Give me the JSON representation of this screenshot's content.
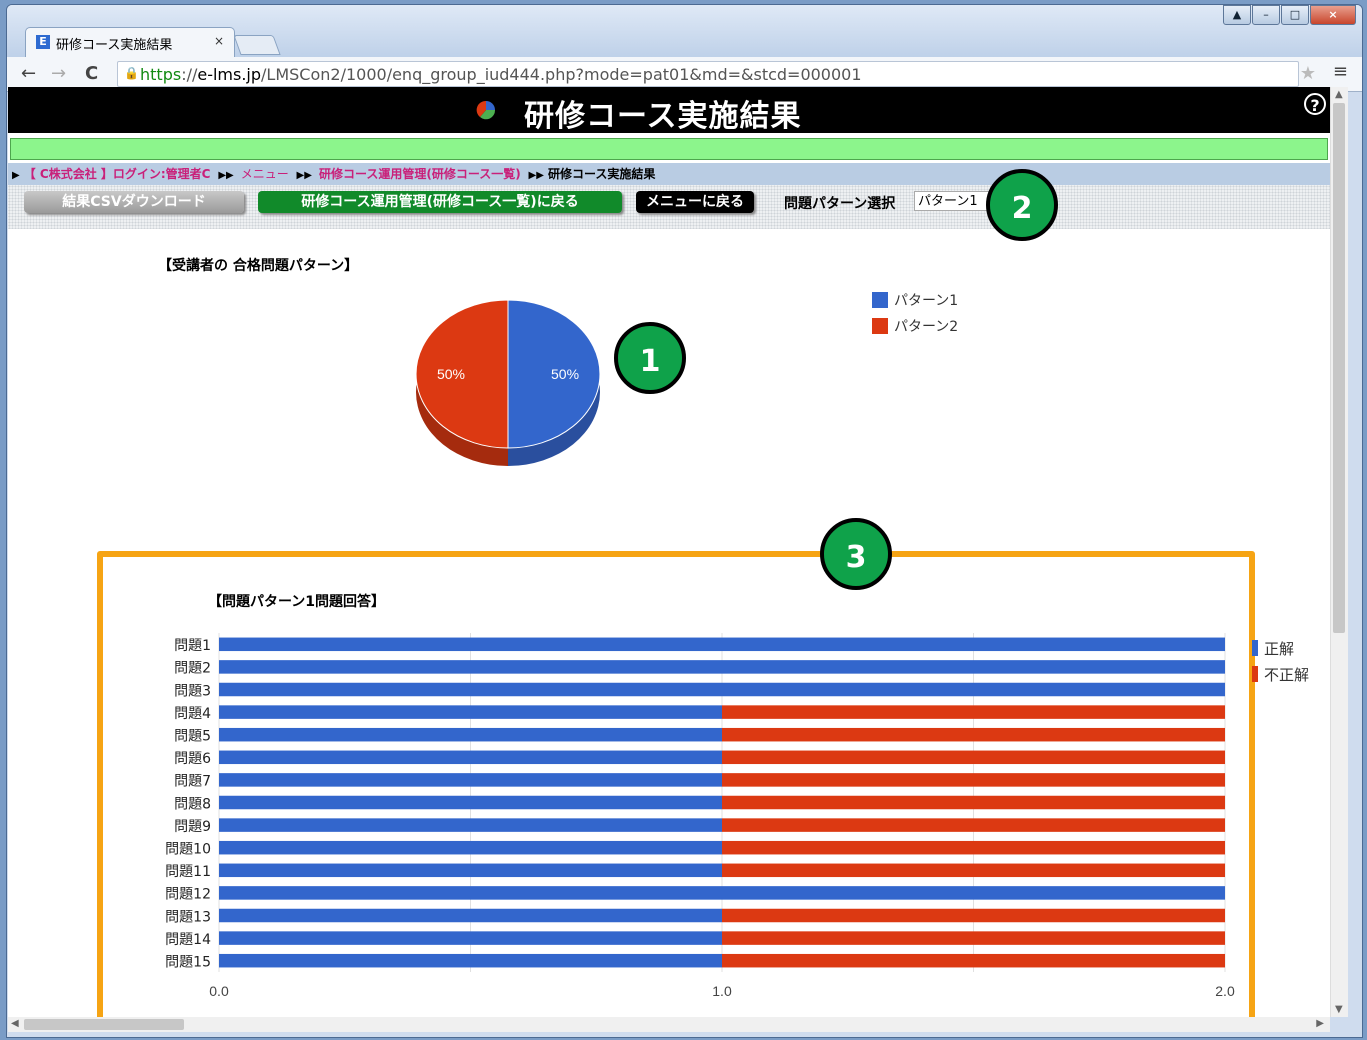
{
  "browser": {
    "tab_title": "研修コース実施結果",
    "tab_favicon": "E",
    "tab_close": "×",
    "url_scheme": "https",
    "url_sep": "://",
    "url_host": "e-lms.jp",
    "url_path": "/LMSCon2/1000/enq_group_iud444.php?mode=pat01&md=&stcd=000001"
  },
  "header": {
    "title": "研修コース実施結果",
    "help": "?"
  },
  "breadcrumb": {
    "company": "【 C株式会社 】ログイン:管理者C",
    "menu": "メニュー",
    "course_admin": "研修コース運用管理(研修コース一覧)",
    "current": "研修コース実施結果",
    "sep": "▶▶"
  },
  "toolbar": {
    "csv_button": "結果CSVダウンロード",
    "back_button": "研修コース運用管理(研修コース一覧)に戻る",
    "menu_button": "メニューに戻る",
    "pattern_label": "問題パターン選択",
    "pattern_value": "パターン1"
  },
  "callouts": [
    "1",
    "2",
    "3"
  ],
  "colors": {
    "blue": "#3366cc",
    "red": "#dc3912",
    "orange": "#f6a414",
    "green": "#0fa24a"
  },
  "chart_data": [
    {
      "type": "pie",
      "title": "【受講者の 合格問題パターン】",
      "labels": [
        "パターン1",
        "パターン2"
      ],
      "values": [
        50,
        50
      ],
      "data_labels": [
        "50%",
        "50%"
      ],
      "legend": "right"
    },
    {
      "type": "bar",
      "orientation": "horizontal",
      "stacked": true,
      "title": "【問題パターン1問題回答】",
      "categories": [
        "問題1",
        "問題2",
        "問題3",
        "問題4",
        "問題5",
        "問題6",
        "問題7",
        "問題8",
        "問題9",
        "問題10",
        "問題11",
        "問題12",
        "問題13",
        "問題14",
        "問題15"
      ],
      "series": [
        {
          "name": "正解",
          "values": [
            2,
            2,
            2,
            1,
            1,
            1,
            1,
            1,
            1,
            1,
            1,
            2,
            1,
            1,
            1
          ]
        },
        {
          "name": "不正解",
          "values": [
            0,
            0,
            0,
            1,
            1,
            1,
            1,
            1,
            1,
            1,
            1,
            0,
            1,
            1,
            1
          ]
        }
      ],
      "xlim": [
        0,
        2
      ],
      "xticks": [
        "0.0",
        "1.0",
        "2.0"
      ],
      "legend": "right"
    }
  ]
}
